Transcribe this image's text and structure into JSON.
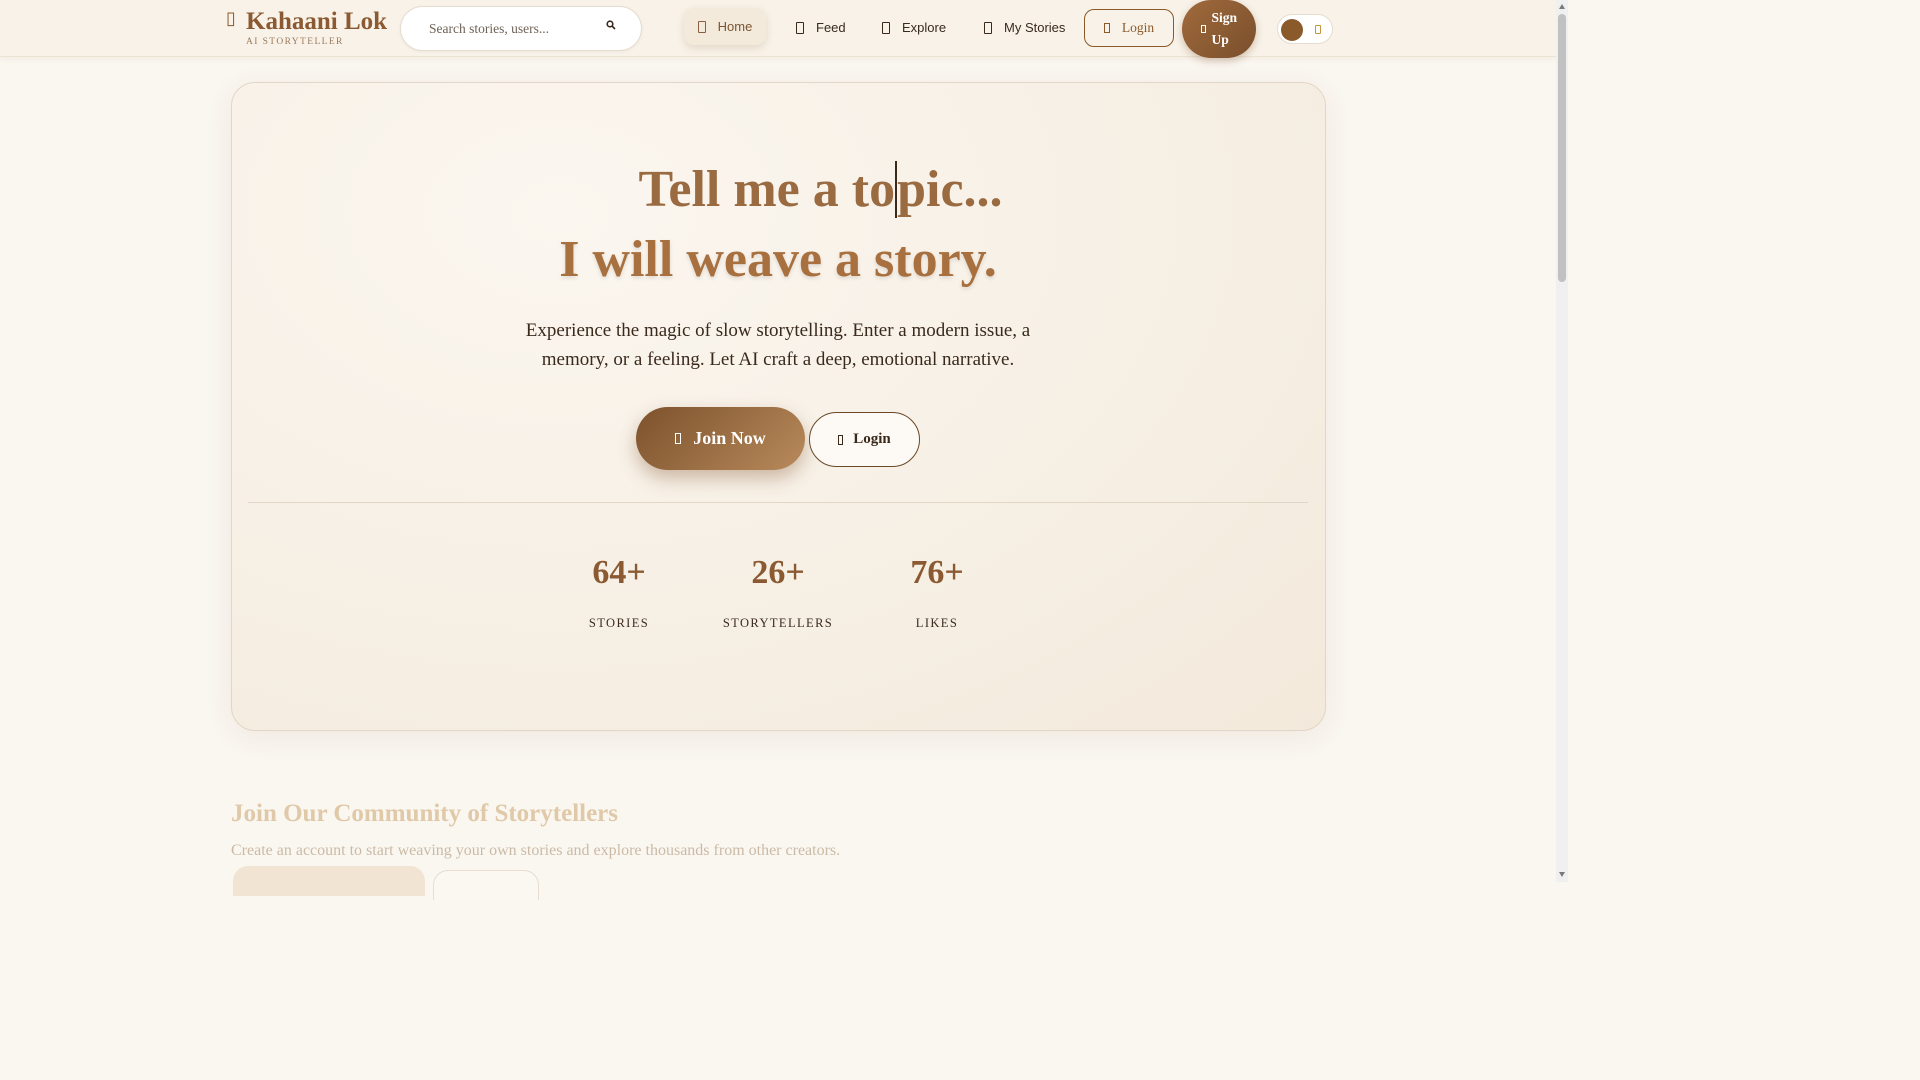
{
  "header": {
    "brand": {
      "title": "Kahaani Lok",
      "subtitle": "AI STORYTELLER",
      "icon": "feather-icon"
    },
    "search": {
      "placeholder": "Search stories, users...",
      "icon": "search-icon"
    },
    "nav": [
      {
        "label": "Home",
        "icon": "home-icon",
        "active": true
      },
      {
        "label": "Feed",
        "icon": "feed-icon"
      },
      {
        "label": "Explore",
        "icon": "compass-icon"
      },
      {
        "label": "My Stories",
        "icon": "book-icon"
      }
    ],
    "login_label": "Login",
    "signup_label": "Sign Up",
    "theme_toggle": {
      "icons": [
        "moon-icon",
        "sun-icon"
      ]
    }
  },
  "hero": {
    "line1": "Tell me a topic...",
    "line1_before_cursor": "Tell me a to",
    "line1_after_cursor": "pic...",
    "line2": "I will weave a story.",
    "description": "Experience the magic of slow storytelling. Enter a modern issue, a memory, or a feeling. Let AI craft a deep, emotional narrative.",
    "join_label": "Join Now",
    "login_label": "Login",
    "stats": [
      {
        "value": "64+",
        "label": "STORIES"
      },
      {
        "value": "26+",
        "label": "STORYTELLERS"
      },
      {
        "value": "76+",
        "label": "LIKES"
      }
    ]
  },
  "community": {
    "title": "Join Our Community of Storytellers",
    "description": "Create an account to start weaving your own stories and explore thousands from other creators."
  },
  "colors": {
    "accent": "#8b5a2b",
    "background": "#faf6f0",
    "text": "#3a2a1c"
  }
}
